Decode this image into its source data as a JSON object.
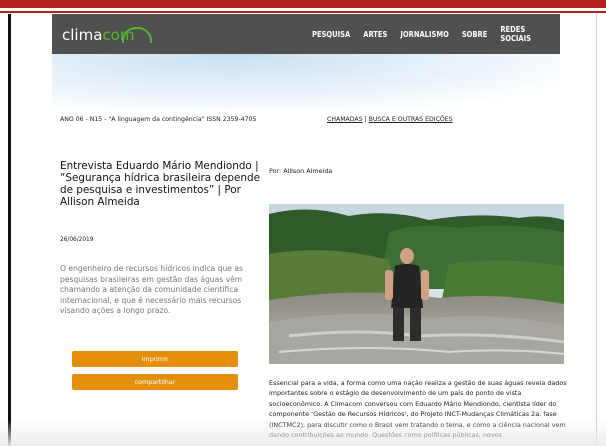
{
  "header": {
    "logo_text_1": "clima",
    "logo_text_2": "com",
    "nav": [
      "PESQUISA",
      "ARTES",
      "JORNALISMO",
      "SOBRE",
      "REDES SOCIAIS"
    ]
  },
  "issue": {
    "line": "ANO 06 - N15 - \"A linguagem da contingência\" ISSN 2359-4705",
    "link1": "CHAMADAS",
    "sep": " | ",
    "link2": "BUSCA E OUTRAS EDIÇÕES"
  },
  "article": {
    "title": "Entrevista Eduardo Mário Mendiondo | “Segurança hídrica brasileira depende de pesquisa e investimentos” | Por Allison Almeida",
    "date": "26/06/2019",
    "lead": "O engenheiro de recursos hídricos indica que as pesquisas brasileiras em gestão das águas vêm chamando a atenção da comunidade científica internacional, e que é necessário mais recursos visando ações a longo prazo.",
    "author": "Por: Allison Almeida",
    "body": "Essencial para a vida, a forma como uma nação realiza a gestão de suas águas revela dados importantes sobre o estágio de desenvolvimento de um país do ponto de vista socioeconômico. A Climacom conversou com Eduardo Mário Mendiondo, cientista líder do componente ‘Gestão de Recursos Hídricos’, do Projeto INCT-Mudanças Climáticas 2a. fase (INCTMC2), para discutir como o Brasil vem tratando o tema, e como a ciência nacional vem dando contribuições ao mundo. Questões como políticas públicas, novos"
  },
  "buttons": {
    "print": "imprimir",
    "share": "compartilhar"
  },
  "colors": {
    "accent_orange": "#e38f0b",
    "header_gray": "#505050",
    "top_red": "#b32020",
    "logo_green": "#55b82e"
  }
}
